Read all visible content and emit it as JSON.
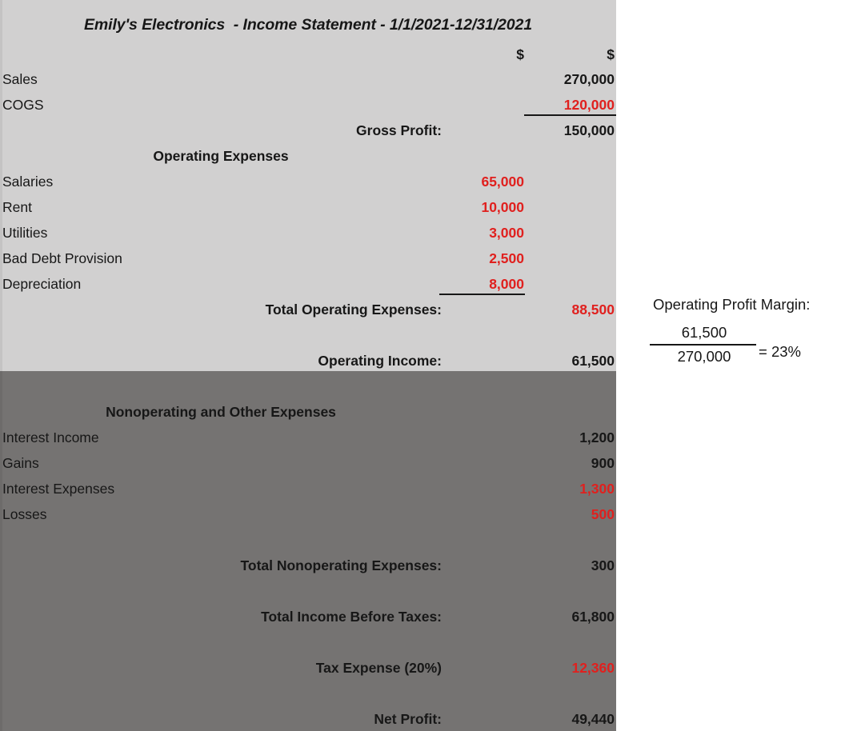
{
  "document": {
    "title": "Emily's Electronics  - Income Statement - 1/1/2021-12/31/2021",
    "colors": {
      "section_light": "#d1d0d0",
      "section_dark": "#757372",
      "negative_value": "#e0201e",
      "text": "#171717"
    },
    "column_headers": {
      "col1": "$",
      "col2": "$"
    },
    "operating_section": {
      "rows": [
        {
          "label": "Sales",
          "col1": "",
          "col2": "270,000",
          "col2_color": "black",
          "bold": false
        },
        {
          "label": "COGS",
          "col1": "",
          "col2": "120,000",
          "col2_color": "red",
          "bold": false
        }
      ],
      "gross_profit": {
        "label": "Gross Profit:",
        "value": "150,000"
      },
      "expenses_heading": "Operating Expenses",
      "expenses": [
        {
          "label": "Salaries",
          "value": "65,000"
        },
        {
          "label": "Rent",
          "value": "10,000"
        },
        {
          "label": "Utilities",
          "value": "3,000"
        },
        {
          "label": "Bad Debt Provision",
          "value": "2,500"
        },
        {
          "label": "Depreciation",
          "value": "8,000"
        }
      ],
      "total_operating_expenses": {
        "label": "Total Operating Expenses:",
        "value": "88,500"
      },
      "operating_income": {
        "label": "Operating Income:",
        "value": "61,500"
      }
    },
    "nonoperating_section": {
      "heading": "Nonoperating and Other Expenses",
      "rows": [
        {
          "label": "Interest Income",
          "value": "1,200",
          "color": "black"
        },
        {
          "label": "Gains",
          "value": "900",
          "color": "black"
        },
        {
          "label": "Interest Expenses",
          "value": "1,300",
          "color": "red"
        },
        {
          "label": "Losses",
          "value": "500",
          "color": "red"
        }
      ],
      "total_nonoperating": {
        "label": "Total Nonoperating Expenses:",
        "value": "300"
      },
      "income_before_taxes": {
        "label": "Total Income Before Taxes:",
        "value": "61,800"
      },
      "tax_expense": {
        "label": "Tax Expense (20%)",
        "value": "12,360"
      },
      "net_profit": {
        "label": "Net Profit:",
        "value": "49,440"
      }
    },
    "margin_callout": {
      "title": "Operating Profit Margin:",
      "numerator": "61,500",
      "denominator": "270,000",
      "result": "= 23%"
    }
  }
}
